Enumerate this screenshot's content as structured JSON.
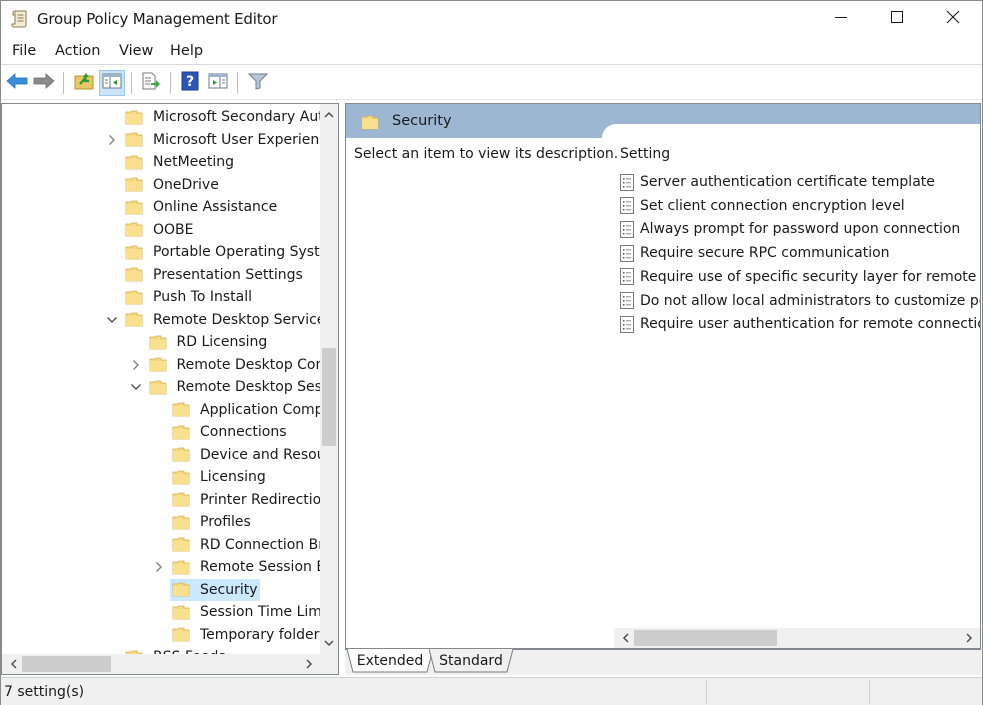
{
  "window": {
    "title": "Group Policy Management Editor",
    "app_icon": "gpo-scroll-icon",
    "controls": [
      "minimize",
      "maximize",
      "close"
    ]
  },
  "menu": {
    "items": [
      {
        "label": "File"
      },
      {
        "label": "Action"
      },
      {
        "label": "View"
      },
      {
        "label": "Help"
      }
    ]
  },
  "toolbar": {
    "buttons": [
      {
        "name": "back",
        "icon": "back-arrow-icon"
      },
      {
        "name": "forward",
        "icon": "forward-arrow-icon"
      },
      {
        "name": "up-one-level",
        "icon": "folder-up-icon"
      },
      {
        "name": "show-hide-console-tree",
        "icon": "console-tree-icon",
        "active": true
      },
      {
        "name": "export-list",
        "icon": "export-list-icon"
      },
      {
        "name": "help",
        "icon": "help-icon"
      },
      {
        "name": "show-hide-action-pane",
        "icon": "action-pane-icon"
      },
      {
        "name": "filter",
        "icon": "filter-icon"
      }
    ]
  },
  "tree": {
    "items": [
      {
        "label": "Microsoft Secondary Autl",
        "level": 0,
        "expander": "none"
      },
      {
        "label": "Microsoft User Experience",
        "level": 0,
        "expander": "collapsed"
      },
      {
        "label": "NetMeeting",
        "level": 0,
        "expander": "none"
      },
      {
        "label": "OneDrive",
        "level": 0,
        "expander": "none"
      },
      {
        "label": "Online Assistance",
        "level": 0,
        "expander": "none"
      },
      {
        "label": "OOBE",
        "level": 0,
        "expander": "none"
      },
      {
        "label": "Portable Operating Syster",
        "level": 0,
        "expander": "none"
      },
      {
        "label": "Presentation Settings",
        "level": 0,
        "expander": "none"
      },
      {
        "label": "Push To Install",
        "level": 0,
        "expander": "none"
      },
      {
        "label": "Remote Desktop Services",
        "level": 0,
        "expander": "expanded"
      },
      {
        "label": "RD Licensing",
        "level": 1,
        "expander": "none"
      },
      {
        "label": "Remote Desktop Conı",
        "level": 1,
        "expander": "collapsed"
      },
      {
        "label": "Remote Desktop Sessi",
        "level": 1,
        "expander": "expanded"
      },
      {
        "label": "Application Comp",
        "level": 2,
        "expander": "none"
      },
      {
        "label": "Connections",
        "level": 2,
        "expander": "none"
      },
      {
        "label": "Device and Resou",
        "level": 2,
        "expander": "none"
      },
      {
        "label": "Licensing",
        "level": 2,
        "expander": "none"
      },
      {
        "label": "Printer Redirection",
        "level": 2,
        "expander": "none"
      },
      {
        "label": "Profiles",
        "level": 2,
        "expander": "none"
      },
      {
        "label": "RD Connection Br",
        "level": 2,
        "expander": "none"
      },
      {
        "label": "Remote Session Er",
        "level": 2,
        "expander": "collapsed"
      },
      {
        "label": "Security",
        "level": 2,
        "expander": "none",
        "selected": true
      },
      {
        "label": "Session Time Limi",
        "level": 2,
        "expander": "none"
      },
      {
        "label": "Temporary folders",
        "level": 2,
        "expander": "none"
      },
      {
        "label": "RSS Feeds",
        "level": 0,
        "expander": "none",
        "partial": true
      }
    ],
    "vscroll": {
      "thumb_start": 0.44,
      "thumb_size": 0.19
    },
    "hscroll": {
      "thumb_start": 0.0,
      "thumb_size": 0.32
    }
  },
  "details": {
    "header_title": "Security",
    "description": "Select an item to view its description.",
    "column_header": "Setting",
    "settings": [
      {
        "label": "Server authentication certificate template"
      },
      {
        "label": "Set client connection encryption level"
      },
      {
        "label": "Always prompt for password upon connection"
      },
      {
        "label": "Require secure RPC communication"
      },
      {
        "label": "Require use of specific security layer for remote (RDP) connections"
      },
      {
        "label": "Do not allow local administrators to customize permissions"
      },
      {
        "label": "Require user authentication for remote connections by using Network Level Authentication"
      }
    ],
    "hscroll": {
      "thumb_start": 0.0,
      "thumb_size": 0.44
    }
  },
  "view_tabs": [
    {
      "label": "Extended",
      "active": true
    },
    {
      "label": "Standard",
      "active": false
    }
  ],
  "status": {
    "text": "7 setting(s)"
  }
}
